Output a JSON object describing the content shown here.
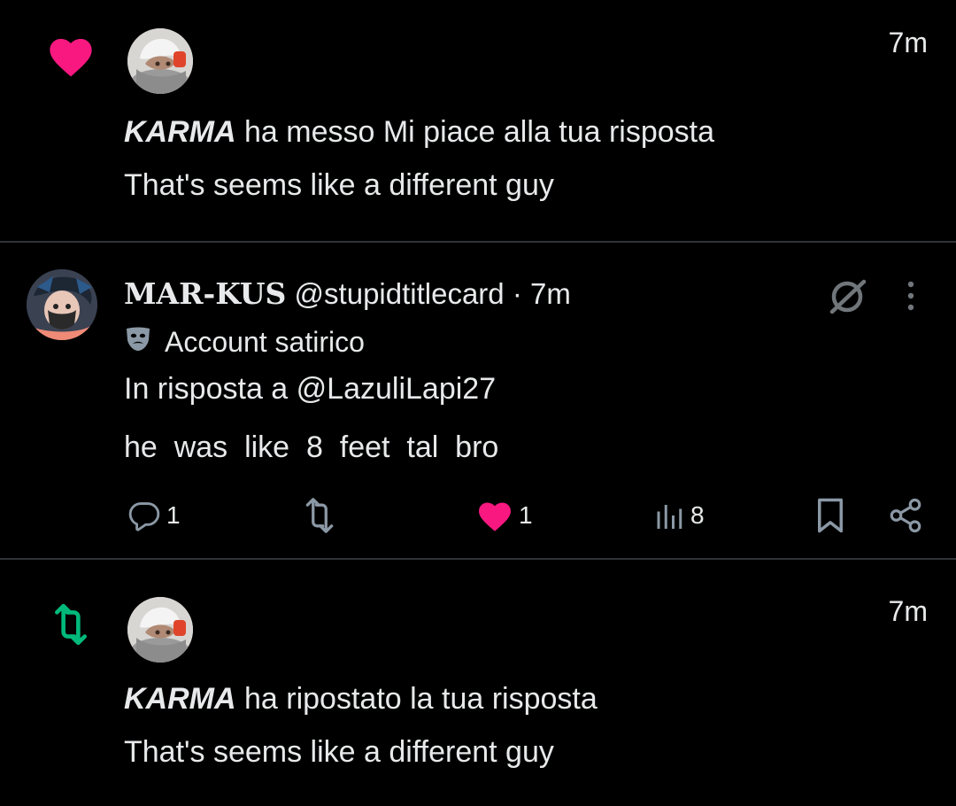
{
  "notifications": [
    {
      "type": "like",
      "icon": "heart-icon",
      "icon_color": "#f91880",
      "time": "7m",
      "actor": "KARMA",
      "action_text": "ha messo Mi piace alla tua risposta",
      "quoted_text": "That's seems like a different guy"
    },
    {
      "type": "repost",
      "icon": "repost-icon",
      "icon_color": "#00ba7c",
      "time": "7m",
      "actor": "KARMA",
      "action_text": "ha ripostato la tua risposta",
      "quoted_text": "That's seems like a different guy"
    }
  ],
  "tweet": {
    "author_name": "MAR-KUS",
    "handle": "@stupidtitlecard",
    "separator": "·",
    "time": "7m",
    "label": "Account satirico",
    "label_icon": "theater-mask-icon",
    "reply_to_prefix": "In risposta a",
    "reply_to_handle": "@LazuliLapi27",
    "text": "he  was  like  8  feet  tal  bro",
    "stats": {
      "replies": "1",
      "likes": "1",
      "views": "8"
    },
    "like_color": "#f91880"
  }
}
